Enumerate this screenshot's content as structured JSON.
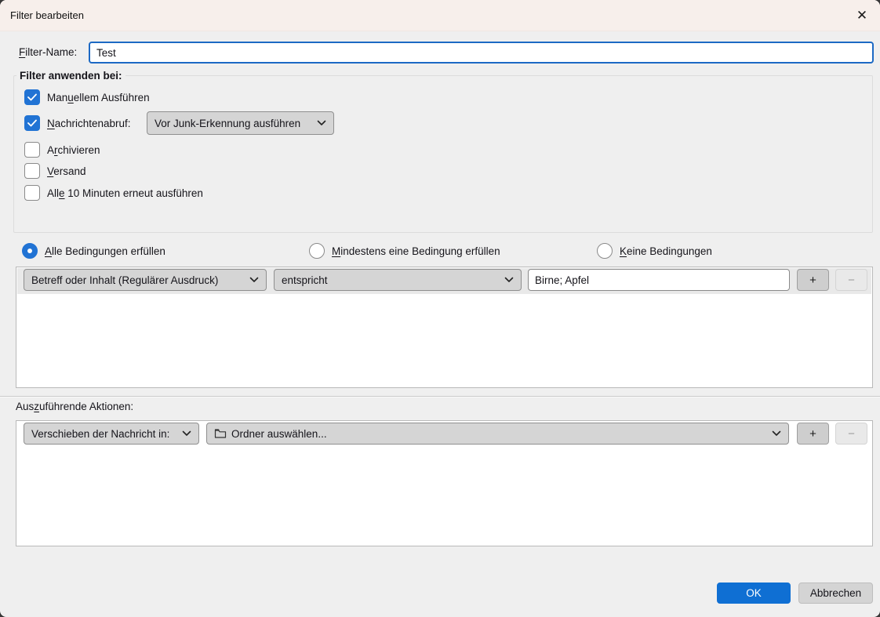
{
  "window": {
    "title": "Filter bearbeiten"
  },
  "icons": {
    "close": "✕",
    "chevron_down": "∨",
    "folder": "🗀",
    "check": "✓"
  },
  "filter_name": {
    "label": {
      "pre": "",
      "key": "F",
      "post": "ilter-Name:"
    },
    "value": "Test"
  },
  "apply_section": {
    "legend": "Filter anwenden bei:",
    "checkboxes": [
      {
        "label": {
          "pre": "Man",
          "key": "u",
          "post": "ellem Ausführen"
        },
        "checked": true
      },
      {
        "label": {
          "pre": "",
          "key": "N",
          "post": "achrichtenabruf:"
        },
        "checked": true
      },
      {
        "label": {
          "pre": "A",
          "key": "r",
          "post": "chivieren"
        },
        "checked": false
      },
      {
        "label": {
          "pre": "",
          "key": "V",
          "post": "ersand"
        },
        "checked": false
      },
      {
        "label": {
          "pre": "All",
          "key": "e",
          "post": " 10 Minuten erneut ausführen"
        },
        "checked": false
      }
    ],
    "fetch_dropdown": {
      "value": "Vor Junk-Erkennung ausführen"
    }
  },
  "match_options": [
    {
      "label": {
        "pre": "",
        "key": "A",
        "post": "lle Bedingungen erfüllen"
      },
      "selected": true
    },
    {
      "label": {
        "pre": "",
        "key": "M",
        "post": "indestens eine Bedingung erfüllen"
      },
      "selected": false
    },
    {
      "label": {
        "pre": "",
        "key": "K",
        "post": "eine Bedingungen"
      },
      "selected": false
    }
  ],
  "conditions": {
    "row": {
      "field_dropdown": "Betreff oder Inhalt (Regulärer Ausdruck)",
      "op_dropdown": "entspricht",
      "value_input": "Birne; Apfel",
      "add_label": "+",
      "remove_label": "−"
    }
  },
  "actions_section": {
    "label": {
      "pre": "Aus",
      "key": "z",
      "post": "uführende Aktionen:"
    },
    "row": {
      "action_dropdown": "Verschieben der Nachricht in:",
      "folder_dropdown": "Ordner auswählen...",
      "add_label": "+",
      "remove_label": "−"
    }
  },
  "footer": {
    "ok_label": "OK",
    "cancel_label": "Abbrechen"
  },
  "colors": {
    "accent_blue": "#1c69c4",
    "checkbox_blue": "#2173d4",
    "ok_blue": "#0f6fd3",
    "titlebar_bg": "#f7efeb",
    "dialog_bg": "#efefef"
  }
}
